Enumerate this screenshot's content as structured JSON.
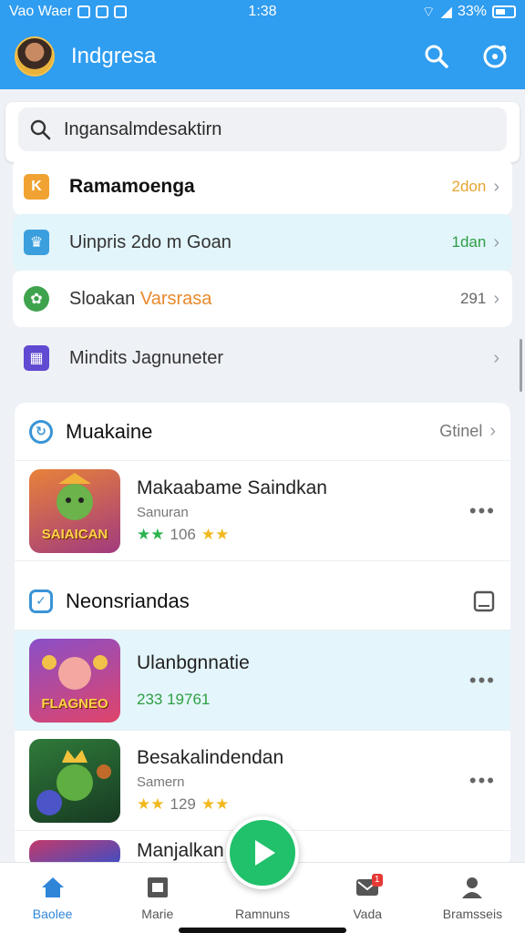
{
  "status": {
    "left_text": "Vao Waer",
    "time": "1:38",
    "battery": "33%"
  },
  "header": {
    "title": "Indgresa"
  },
  "search": {
    "text": "Ingansalmdesaktirn"
  },
  "rows": [
    {
      "label": "Ramamoenga",
      "value": "2don",
      "value_color": "#e6a532",
      "icon_color": "#f0a232"
    },
    {
      "label": "Uinpris 2do m Goan",
      "value": "1dan",
      "value_color": "#2f9e44",
      "icon_color": "#3b9fde"
    },
    {
      "label": "Sloakan",
      "highlight": "Varsrasa",
      "value": "291",
      "value_color": "#666",
      "icon_color": "#3fa34d"
    },
    {
      "label": "Mindits Jagnuneter",
      "value": "",
      "value_color": "#666",
      "icon_color": "#5f4ad1"
    }
  ],
  "section1": {
    "title": "Muakaine",
    "action": "Gtinel"
  },
  "section2": {
    "title": "Neonsriandas"
  },
  "games": [
    {
      "title": "Makaabame Saindkan",
      "subtitle": "Sanuran",
      "rating": "106",
      "thumb_text": "SAIAICAN"
    },
    {
      "title": "Ulanbgnnatie",
      "rating": "233 19761",
      "thumb_text": "FLAGNEO"
    },
    {
      "title": "Besakalindendan",
      "subtitle": "Samern",
      "rating": "129",
      "thumb_text": ""
    },
    {
      "title": "Manjalkan"
    }
  ],
  "nav": [
    {
      "label": "Baolee",
      "icon": "home-icon"
    },
    {
      "label": "Marie",
      "icon": "card-icon"
    },
    {
      "label": "Ramnuns",
      "icon": "play-icon"
    },
    {
      "label": "Vada",
      "icon": "mail-icon",
      "badge": "1"
    },
    {
      "label": "Bramsseis",
      "icon": "person-icon"
    }
  ],
  "colors": {
    "primary": "#2f9df0",
    "fab": "#21c06b",
    "highlight_row": "#e2f5fb"
  }
}
